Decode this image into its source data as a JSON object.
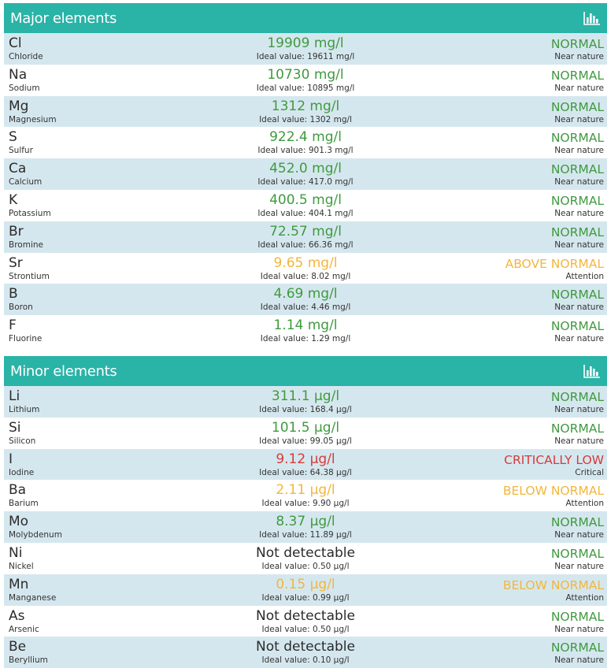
{
  "colors": {
    "header_bg": "#2ab3a7",
    "row_alt": "#d5e7ee",
    "normal": "#3f9a3f",
    "attention": "#f2b63c",
    "critical": "#d83a3a",
    "neutral": "#2b2b2b"
  },
  "sections": [
    {
      "title": "Major elements",
      "icon": "bar-chart-icon",
      "rows": [
        {
          "symbol": "Cl",
          "name": "Chloride",
          "value": "19909 mg/l",
          "ideal": "Ideal value: 19611 mg/l",
          "status": "NORMAL",
          "note": "Near nature",
          "level": "normal"
        },
        {
          "symbol": "Na",
          "name": "Sodium",
          "value": "10730 mg/l",
          "ideal": "Ideal value: 10895 mg/l",
          "status": "NORMAL",
          "note": "Near nature",
          "level": "normal"
        },
        {
          "symbol": "Mg",
          "name": "Magnesium",
          "value": "1312 mg/l",
          "ideal": "Ideal value: 1302 mg/l",
          "status": "NORMAL",
          "note": "Near nature",
          "level": "normal"
        },
        {
          "symbol": "S",
          "name": "Sulfur",
          "value": "922.4 mg/l",
          "ideal": "Ideal value: 901.3 mg/l",
          "status": "NORMAL",
          "note": "Near nature",
          "level": "normal"
        },
        {
          "symbol": "Ca",
          "name": "Calcium",
          "value": "452.0 mg/l",
          "ideal": "Ideal value: 417.0 mg/l",
          "status": "NORMAL",
          "note": "Near nature",
          "level": "normal"
        },
        {
          "symbol": "K",
          "name": "Potassium",
          "value": "400.5 mg/l",
          "ideal": "Ideal value: 404.1 mg/l",
          "status": "NORMAL",
          "note": "Near nature",
          "level": "normal"
        },
        {
          "symbol": "Br",
          "name": "Bromine",
          "value": "72.57 mg/l",
          "ideal": "Ideal value: 66.36 mg/l",
          "status": "NORMAL",
          "note": "Near nature",
          "level": "normal"
        },
        {
          "symbol": "Sr",
          "name": "Strontium",
          "value": "9.65 mg/l",
          "ideal": "Ideal value: 8.02 mg/l",
          "status": "ABOVE NORMAL",
          "note": "Attention",
          "level": "attention"
        },
        {
          "symbol": "B",
          "name": "Boron",
          "value": "4.69 mg/l",
          "ideal": "Ideal value: 4.46 mg/l",
          "status": "NORMAL",
          "note": "Near nature",
          "level": "normal"
        },
        {
          "symbol": "F",
          "name": "Fluorine",
          "value": "1.14 mg/l",
          "ideal": "Ideal value: 1.29 mg/l",
          "status": "NORMAL",
          "note": "Near nature",
          "level": "normal"
        }
      ]
    },
    {
      "title": "Minor elements",
      "icon": "bar-chart-icon",
      "rows": [
        {
          "symbol": "Li",
          "name": "Lithium",
          "value": "311.1 µg/l",
          "ideal": "Ideal value: 168.4 µg/l",
          "status": "NORMAL",
          "note": "Near nature",
          "level": "normal"
        },
        {
          "symbol": "Si",
          "name": "Silicon",
          "value": "101.5 µg/l",
          "ideal": "Ideal value: 99.05 µg/l",
          "status": "NORMAL",
          "note": "Near nature",
          "level": "normal"
        },
        {
          "symbol": "I",
          "name": "Iodine",
          "value": "9.12 µg/l",
          "ideal": "Ideal value: 64.38 µg/l",
          "status": "CRITICALLY LOW",
          "note": "Critical",
          "level": "critical"
        },
        {
          "symbol": "Ba",
          "name": "Barium",
          "value": "2.11 µg/l",
          "ideal": "Ideal value: 9.90 µg/l",
          "status": "BELOW NORMAL",
          "note": "Attention",
          "level": "attention"
        },
        {
          "symbol": "Mo",
          "name": "Molybdenum",
          "value": "8.37 µg/l",
          "ideal": "Ideal value: 11.89 µg/l",
          "status": "NORMAL",
          "note": "Near nature",
          "level": "normal"
        },
        {
          "symbol": "Ni",
          "name": "Nickel",
          "value": "Not detectable",
          "ideal": "Ideal value: 0.50 µg/l",
          "status": "NORMAL",
          "note": "Near nature",
          "level": "normal",
          "value_level": "neutral"
        },
        {
          "symbol": "Mn",
          "name": "Manganese",
          "value": "0.15 µg/l",
          "ideal": "Ideal value: 0.99 µg/l",
          "status": "BELOW NORMAL",
          "note": "Attention",
          "level": "attention"
        },
        {
          "symbol": "As",
          "name": "Arsenic",
          "value": "Not detectable",
          "ideal": "Ideal value: 0.50 µg/l",
          "status": "NORMAL",
          "note": "Near nature",
          "level": "normal",
          "value_level": "neutral"
        },
        {
          "symbol": "Be",
          "name": "Beryllium",
          "value": "Not detectable",
          "ideal": "Ideal value: 0.10 µg/l",
          "status": "NORMAL",
          "note": "Near nature",
          "level": "normal",
          "value_level": "neutral"
        }
      ]
    }
  ]
}
